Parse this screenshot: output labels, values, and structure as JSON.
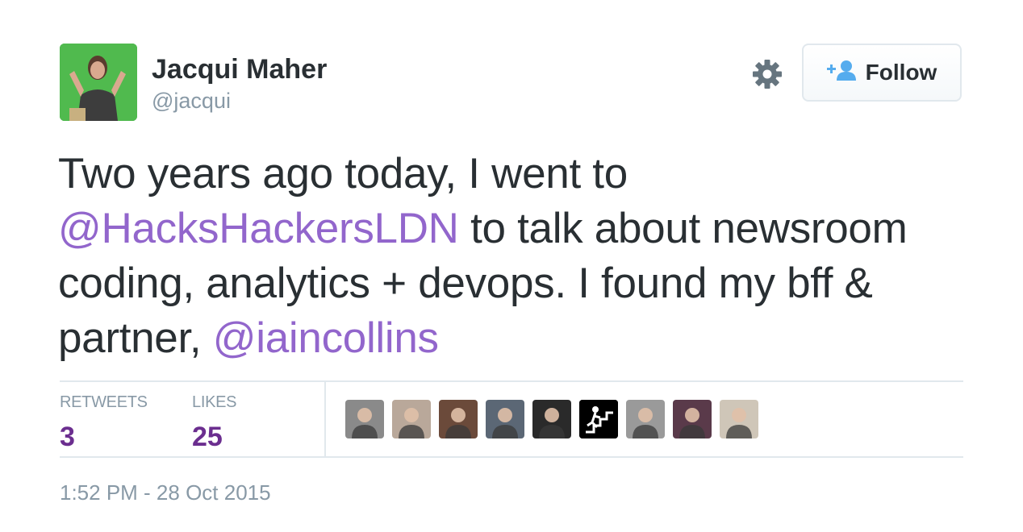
{
  "user": {
    "name": "Jacqui Maher",
    "handle": "@jacqui"
  },
  "actions": {
    "follow_label": "Follow"
  },
  "tweet": {
    "line1": "Two years ago today, I went to",
    "mention1": "@HacksHackersLDN",
    "line2": " to talk about newsroom coding, analytics + devops. I found my bff & partner, ",
    "mention2": "@iaincollins"
  },
  "stats": {
    "retweets_label": "RETWEETS",
    "retweets_count": "3",
    "likes_label": "LIKES",
    "likes_count": "25"
  },
  "likers": [
    {
      "name": "liker-avatar-1",
      "bg": "#8a8a8a"
    },
    {
      "name": "liker-avatar-2",
      "bg": "#b9a89a"
    },
    {
      "name": "liker-avatar-3",
      "bg": "#6b4a3a"
    },
    {
      "name": "liker-avatar-4",
      "bg": "#5b6775"
    },
    {
      "name": "liker-avatar-5",
      "bg": "#2a2a2a"
    },
    {
      "name": "liker-avatar-6",
      "bg": "#000000"
    },
    {
      "name": "liker-avatar-7",
      "bg": "#9a9a9a"
    },
    {
      "name": "liker-avatar-8",
      "bg": "#5a3a4a"
    },
    {
      "name": "liker-avatar-9",
      "bg": "#cfc6b8"
    }
  ],
  "timestamp": "1:52 PM - 28 Oct 2015",
  "colors": {
    "mention": "#9266cc",
    "count": "#6b2e8f",
    "muted": "#8899a6",
    "follow_icon": "#55acee"
  },
  "icons": {
    "settings": "gear-icon",
    "follow": "follow-person-plus-icon"
  }
}
